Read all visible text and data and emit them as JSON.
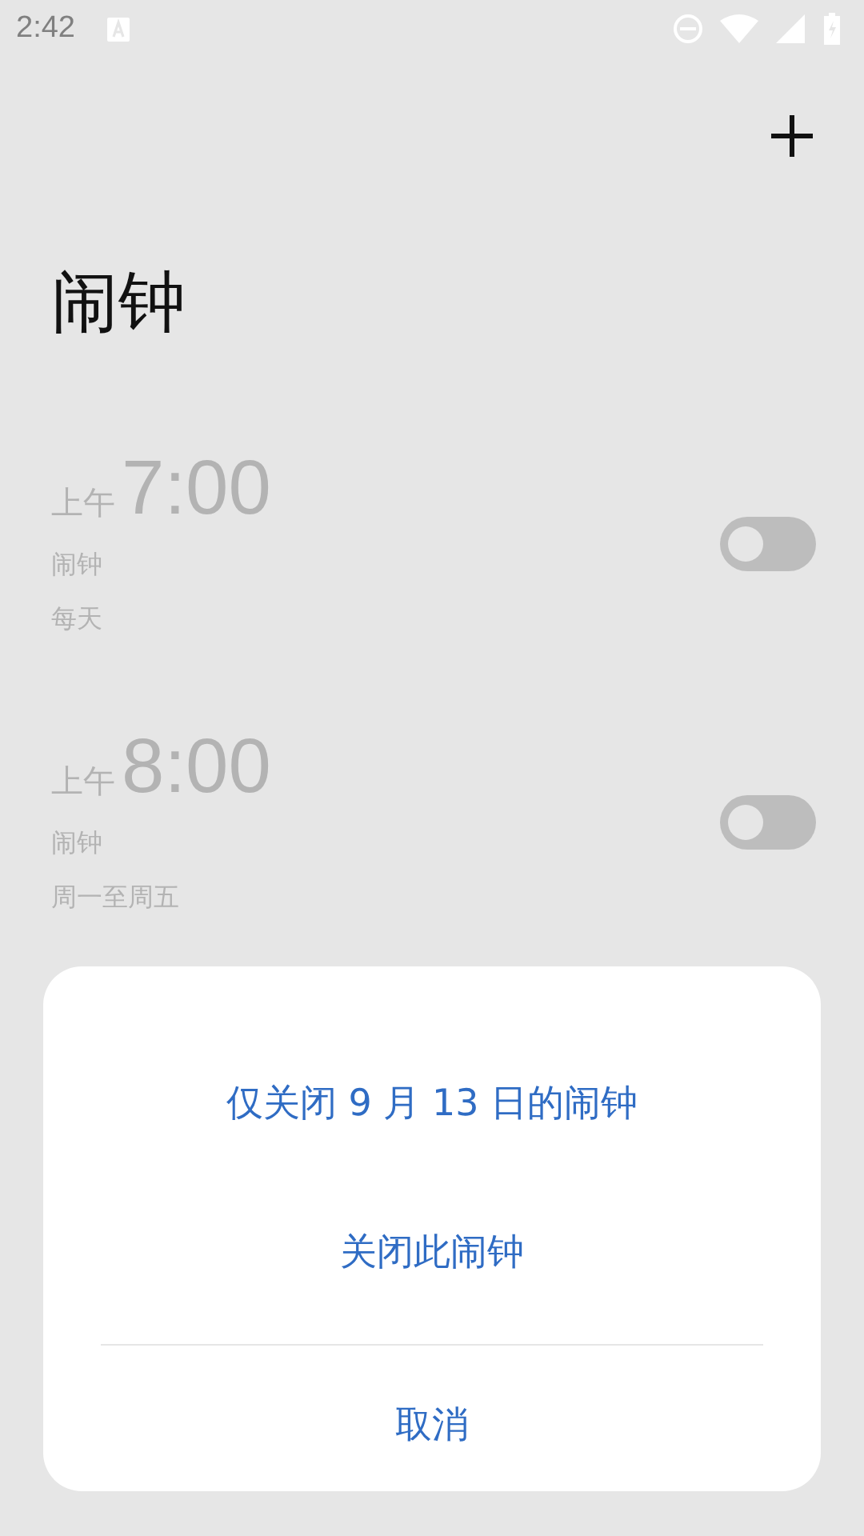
{
  "status_bar": {
    "time": "2:42"
  },
  "title": "闹钟",
  "alarms": [
    {
      "period": "上午",
      "time": "7:00",
      "label": "闹钟",
      "repeat": "每天",
      "on": false
    },
    {
      "period": "上午",
      "time": "8:00",
      "label": "闹钟",
      "repeat": "周一至周五",
      "on": false
    }
  ],
  "dialog": {
    "options": [
      "仅关闭 9 月 13 日的闹钟",
      "关闭此闹钟"
    ],
    "cancel": "取消"
  }
}
